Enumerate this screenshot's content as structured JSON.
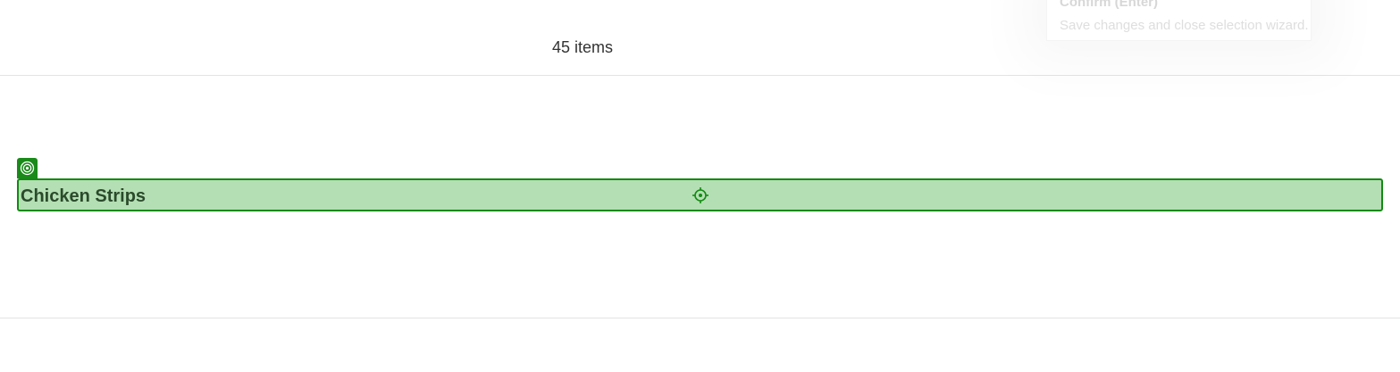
{
  "header": {
    "items_count": "45 items"
  },
  "tooltip": {
    "title": "Confirm (Enter)",
    "description": "Save changes and close selection wizard."
  },
  "selection": {
    "badge_icon": "target-icon",
    "row_label": "Chicken Strips",
    "center_icon": "crosshair-icon"
  },
  "colors": {
    "accent": "#138a13",
    "row_fill": "#b4dfb4",
    "row_text": "#2b4a2b"
  }
}
